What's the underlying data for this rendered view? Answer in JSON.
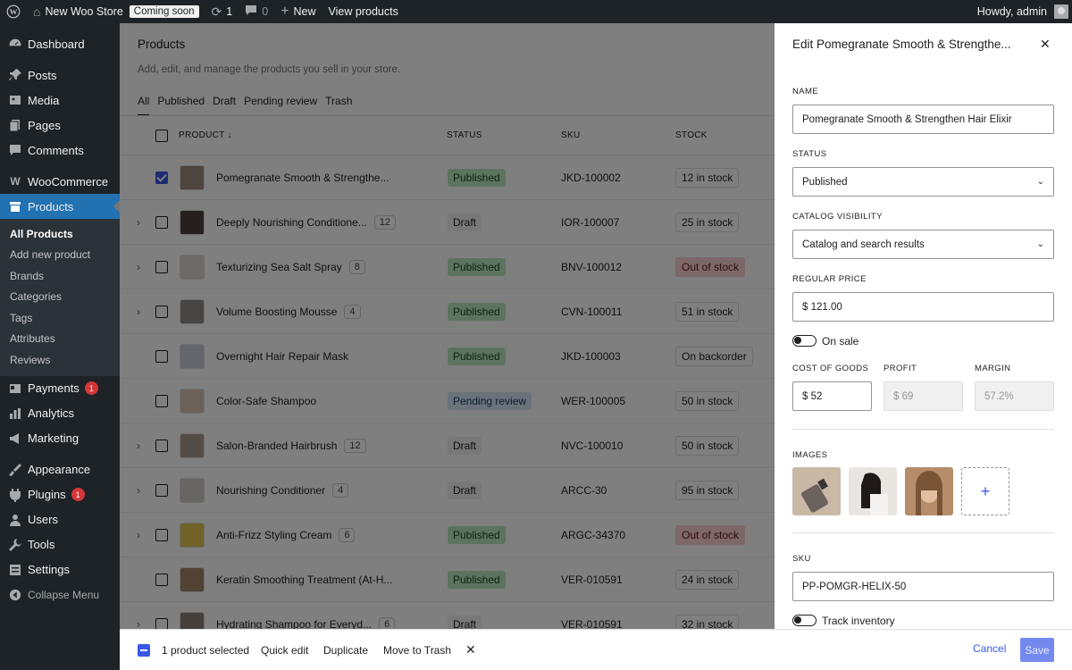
{
  "admin_bar": {
    "site_name": "New Woo Store",
    "coming_soon": "Coming soon",
    "updates_count": "1",
    "comments_count": "0",
    "new_label": "New",
    "view_products": "View products",
    "howdy": "Howdy, admin"
  },
  "sidebar": {
    "dashboard": "Dashboard",
    "posts": "Posts",
    "media": "Media",
    "pages": "Pages",
    "comments": "Comments",
    "woocommerce": "WooCommerce",
    "products": "Products",
    "submenu": [
      "All Products",
      "Add new product",
      "Brands",
      "Categories",
      "Tags",
      "Attributes",
      "Reviews"
    ],
    "payments": "Payments",
    "payments_count": "1",
    "analytics": "Analytics",
    "marketing": "Marketing",
    "appearance": "Appearance",
    "plugins": "Plugins",
    "plugins_count": "1",
    "users": "Users",
    "tools": "Tools",
    "settings": "Settings",
    "collapse": "Collapse Menu"
  },
  "main": {
    "title": "Products",
    "subtitle": "Add, edit, and manage the products you sell in your store.",
    "tabs": [
      "All",
      "Published",
      "Draft",
      "Pending review",
      "Trash"
    ],
    "columns": {
      "product": "PRODUCT ↓",
      "status": "STATUS",
      "sku": "SKU",
      "stock": "STOCK"
    },
    "rows": [
      {
        "name": "Pomegranate Smooth & Strengthe...",
        "count": "",
        "status": "Published",
        "sku": "JKD-100002",
        "stock": "12 in stock",
        "checked": true,
        "expand": false,
        "stock_type": "in"
      },
      {
        "name": "Deeply Nourishing Conditione...",
        "count": "12",
        "status": "Draft",
        "sku": "IOR-100007",
        "stock": "25 in stock",
        "checked": false,
        "expand": true,
        "stock_type": "in"
      },
      {
        "name": "Texturizing Sea Salt Spray",
        "count": "8",
        "status": "Published",
        "sku": "BNV-100012",
        "stock": "Out of stock",
        "checked": false,
        "expand": true,
        "stock_type": "out"
      },
      {
        "name": "Volume Boosting Mousse",
        "count": "4",
        "status": "Published",
        "sku": "CVN-100011",
        "stock": "51 in stock",
        "checked": false,
        "expand": true,
        "stock_type": "in"
      },
      {
        "name": "Overnight Hair Repair Mask",
        "count": "",
        "status": "Published",
        "sku": "JKD-100003",
        "stock": "On backorder",
        "checked": false,
        "expand": false,
        "stock_type": "in"
      },
      {
        "name": "Color-Safe Shampoo",
        "count": "",
        "status": "Pending review",
        "sku": "WER-100005",
        "stock": "50 in stock",
        "checked": false,
        "expand": false,
        "stock_type": "in"
      },
      {
        "name": "Salon-Branded Hairbrush",
        "count": "12",
        "status": "Draft",
        "sku": "NVC-100010",
        "stock": "50 in stock",
        "checked": false,
        "expand": true,
        "stock_type": "in"
      },
      {
        "name": "Nourishing Conditioner",
        "count": "4",
        "status": "Draft",
        "sku": "ARCC-30",
        "stock": "95 in stock",
        "checked": false,
        "expand": true,
        "stock_type": "in"
      },
      {
        "name": "Anti-Frizz Styling Cream",
        "count": "6",
        "status": "Published",
        "sku": "ARGC-34370",
        "stock": "Out of stock",
        "checked": false,
        "expand": true,
        "stock_type": "out"
      },
      {
        "name": "Keratin Smoothing Treatment (At-H...",
        "count": "",
        "status": "Published",
        "sku": "VER-010591",
        "stock": "24 in stock",
        "checked": false,
        "expand": false,
        "stock_type": "in"
      },
      {
        "name": "Hydrating Shampoo for Everyd...",
        "count": "6",
        "status": "Draft",
        "sku": "VER-010591",
        "stock": "32 in stock",
        "checked": false,
        "expand": true,
        "stock_type": "in"
      }
    ],
    "bulk": {
      "selected": "1 product selected",
      "quick_edit": "Quick edit",
      "duplicate": "Duplicate",
      "trash": "Move to Trash"
    }
  },
  "panel": {
    "title": "Edit Pomegranate Smooth & Strengthe...",
    "name_label": "NAME",
    "name_value": "Pomegranate Smooth & Strengthen Hair Elixir",
    "status_label": "STATUS",
    "status_value": "Published",
    "visibility_label": "CATALOG VISIBILITY",
    "visibility_value": "Catalog and search results",
    "price_label": "REGULAR PRICE",
    "price_value": "$ 121.00",
    "on_sale_label": "On sale",
    "cost_label": "COST OF GOODS",
    "cost_value": "$ 52",
    "profit_label": "PROFIT",
    "profit_value": "$ 69",
    "margin_label": "MARGIN",
    "margin_value": "57.2%",
    "images_label": "IMAGES",
    "sku_label": "SKU",
    "sku_value": "PP-POMGR-HELIX-50",
    "track_inventory": "Track inventory",
    "cancel": "Cancel",
    "save": "Save"
  }
}
